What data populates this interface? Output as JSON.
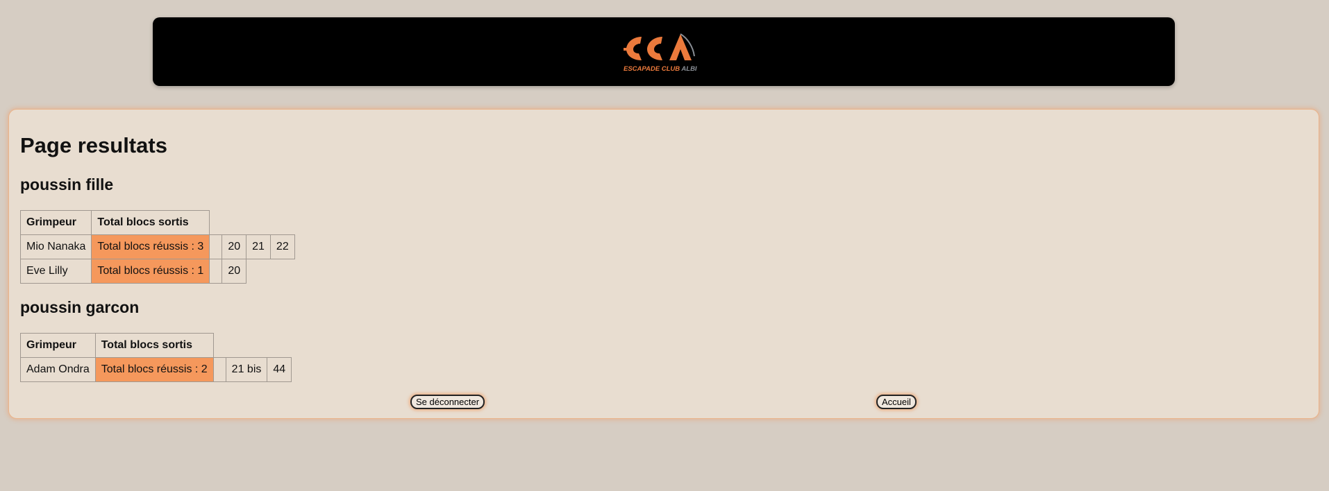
{
  "header": {
    "logo_alt": "ECA - Escapade Club Albi",
    "logo_text": "ESCAPADE CLUB ALBI"
  },
  "page_title": "Page resultats",
  "categories": [
    {
      "title": "poussin fille",
      "columns": [
        "Grimpeur",
        "Total blocs sortis"
      ],
      "rows": [
        {
          "name": "Mio Nanaka",
          "total": "Total blocs réussis : 3",
          "blocs": [
            "20",
            "21",
            "22"
          ]
        },
        {
          "name": "Eve Lilly",
          "total": "Total blocs réussis : 1",
          "blocs": [
            "20"
          ]
        }
      ]
    },
    {
      "title": "poussin garcon",
      "columns": [
        "Grimpeur",
        "Total blocs sortis"
      ],
      "rows": [
        {
          "name": "Adam Ondra",
          "total": "Total blocs réussis : 2",
          "blocs": [
            "21 bis",
            "44"
          ]
        }
      ]
    }
  ],
  "buttons": {
    "logout": "Se déconnecter",
    "home": "Accueil"
  },
  "colors": {
    "total_cell": "#f5985c",
    "accent": "#eb7a3c"
  }
}
